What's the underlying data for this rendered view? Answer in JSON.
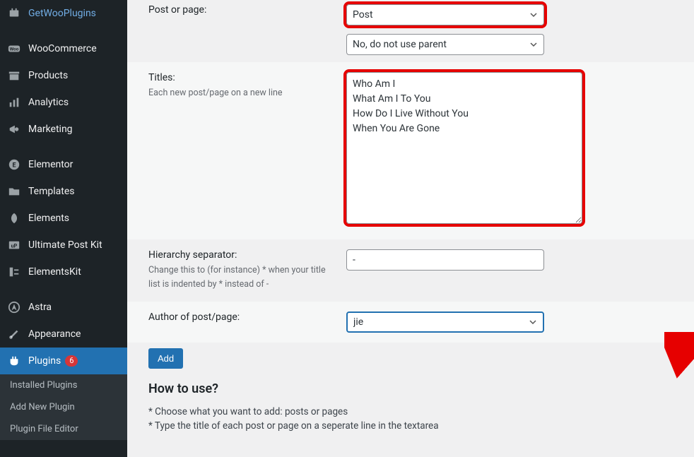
{
  "sidebar": {
    "items": [
      {
        "label": "GetWooPlugins",
        "name": "sidebar-item-getwooplugins",
        "icon": "plug"
      },
      {
        "sep": true
      },
      {
        "label": "WooCommerce",
        "name": "sidebar-item-woocommerce",
        "icon": "woo"
      },
      {
        "label": "Products",
        "name": "sidebar-item-products",
        "icon": "archive"
      },
      {
        "label": "Analytics",
        "name": "sidebar-item-analytics",
        "icon": "chart"
      },
      {
        "label": "Marketing",
        "name": "sidebar-item-marketing",
        "icon": "megaphone"
      },
      {
        "sep": true
      },
      {
        "label": "Elementor",
        "name": "sidebar-item-elementor",
        "icon": "e-circle"
      },
      {
        "label": "Templates",
        "name": "sidebar-item-templates",
        "icon": "folder"
      },
      {
        "label": "Elements",
        "name": "sidebar-item-elements",
        "icon": "leaf"
      },
      {
        "label": "Ultimate Post Kit",
        "name": "sidebar-item-upk",
        "icon": "upk"
      },
      {
        "label": "ElementsKit",
        "name": "sidebar-item-elementskit",
        "icon": "ekit"
      },
      {
        "sep": true
      },
      {
        "label": "Astra",
        "name": "sidebar-item-astra",
        "icon": "astra"
      },
      {
        "label": "Appearance",
        "name": "sidebar-item-appearance",
        "icon": "brush"
      },
      {
        "label": "Plugins",
        "name": "sidebar-item-plugins",
        "icon": "plugin",
        "active": true,
        "badge": "6"
      }
    ],
    "submenu": [
      {
        "label": "Installed Plugins",
        "name": "submenu-installed-plugins"
      },
      {
        "label": "Add New Plugin",
        "name": "submenu-add-new-plugin"
      },
      {
        "label": "Plugin File Editor",
        "name": "submenu-plugin-file-editor"
      }
    ]
  },
  "form": {
    "post_or_page": {
      "label": "Post or page:",
      "value": "Post"
    },
    "parent": {
      "value": "No, do not use parent"
    },
    "titles": {
      "label": "Titles:",
      "desc": "Each new post/page on a new line",
      "value": "Who Am I\nWhat Am I To You\nHow Do I Live Without You\nWhen You Are Gone"
    },
    "hierarchy": {
      "label": "Hierarchy separator:",
      "desc": "Change this to (for instance) * when your title list is indented by * instead of -",
      "value": "-"
    },
    "author": {
      "label": "Author of post/page:",
      "value": "jie"
    },
    "add_button": "Add"
  },
  "howto": {
    "title": "How to use?",
    "lines": [
      "* Choose what you want to add: posts or pages",
      "* Type the title of each post or page on a seperate line in the textarea"
    ]
  }
}
